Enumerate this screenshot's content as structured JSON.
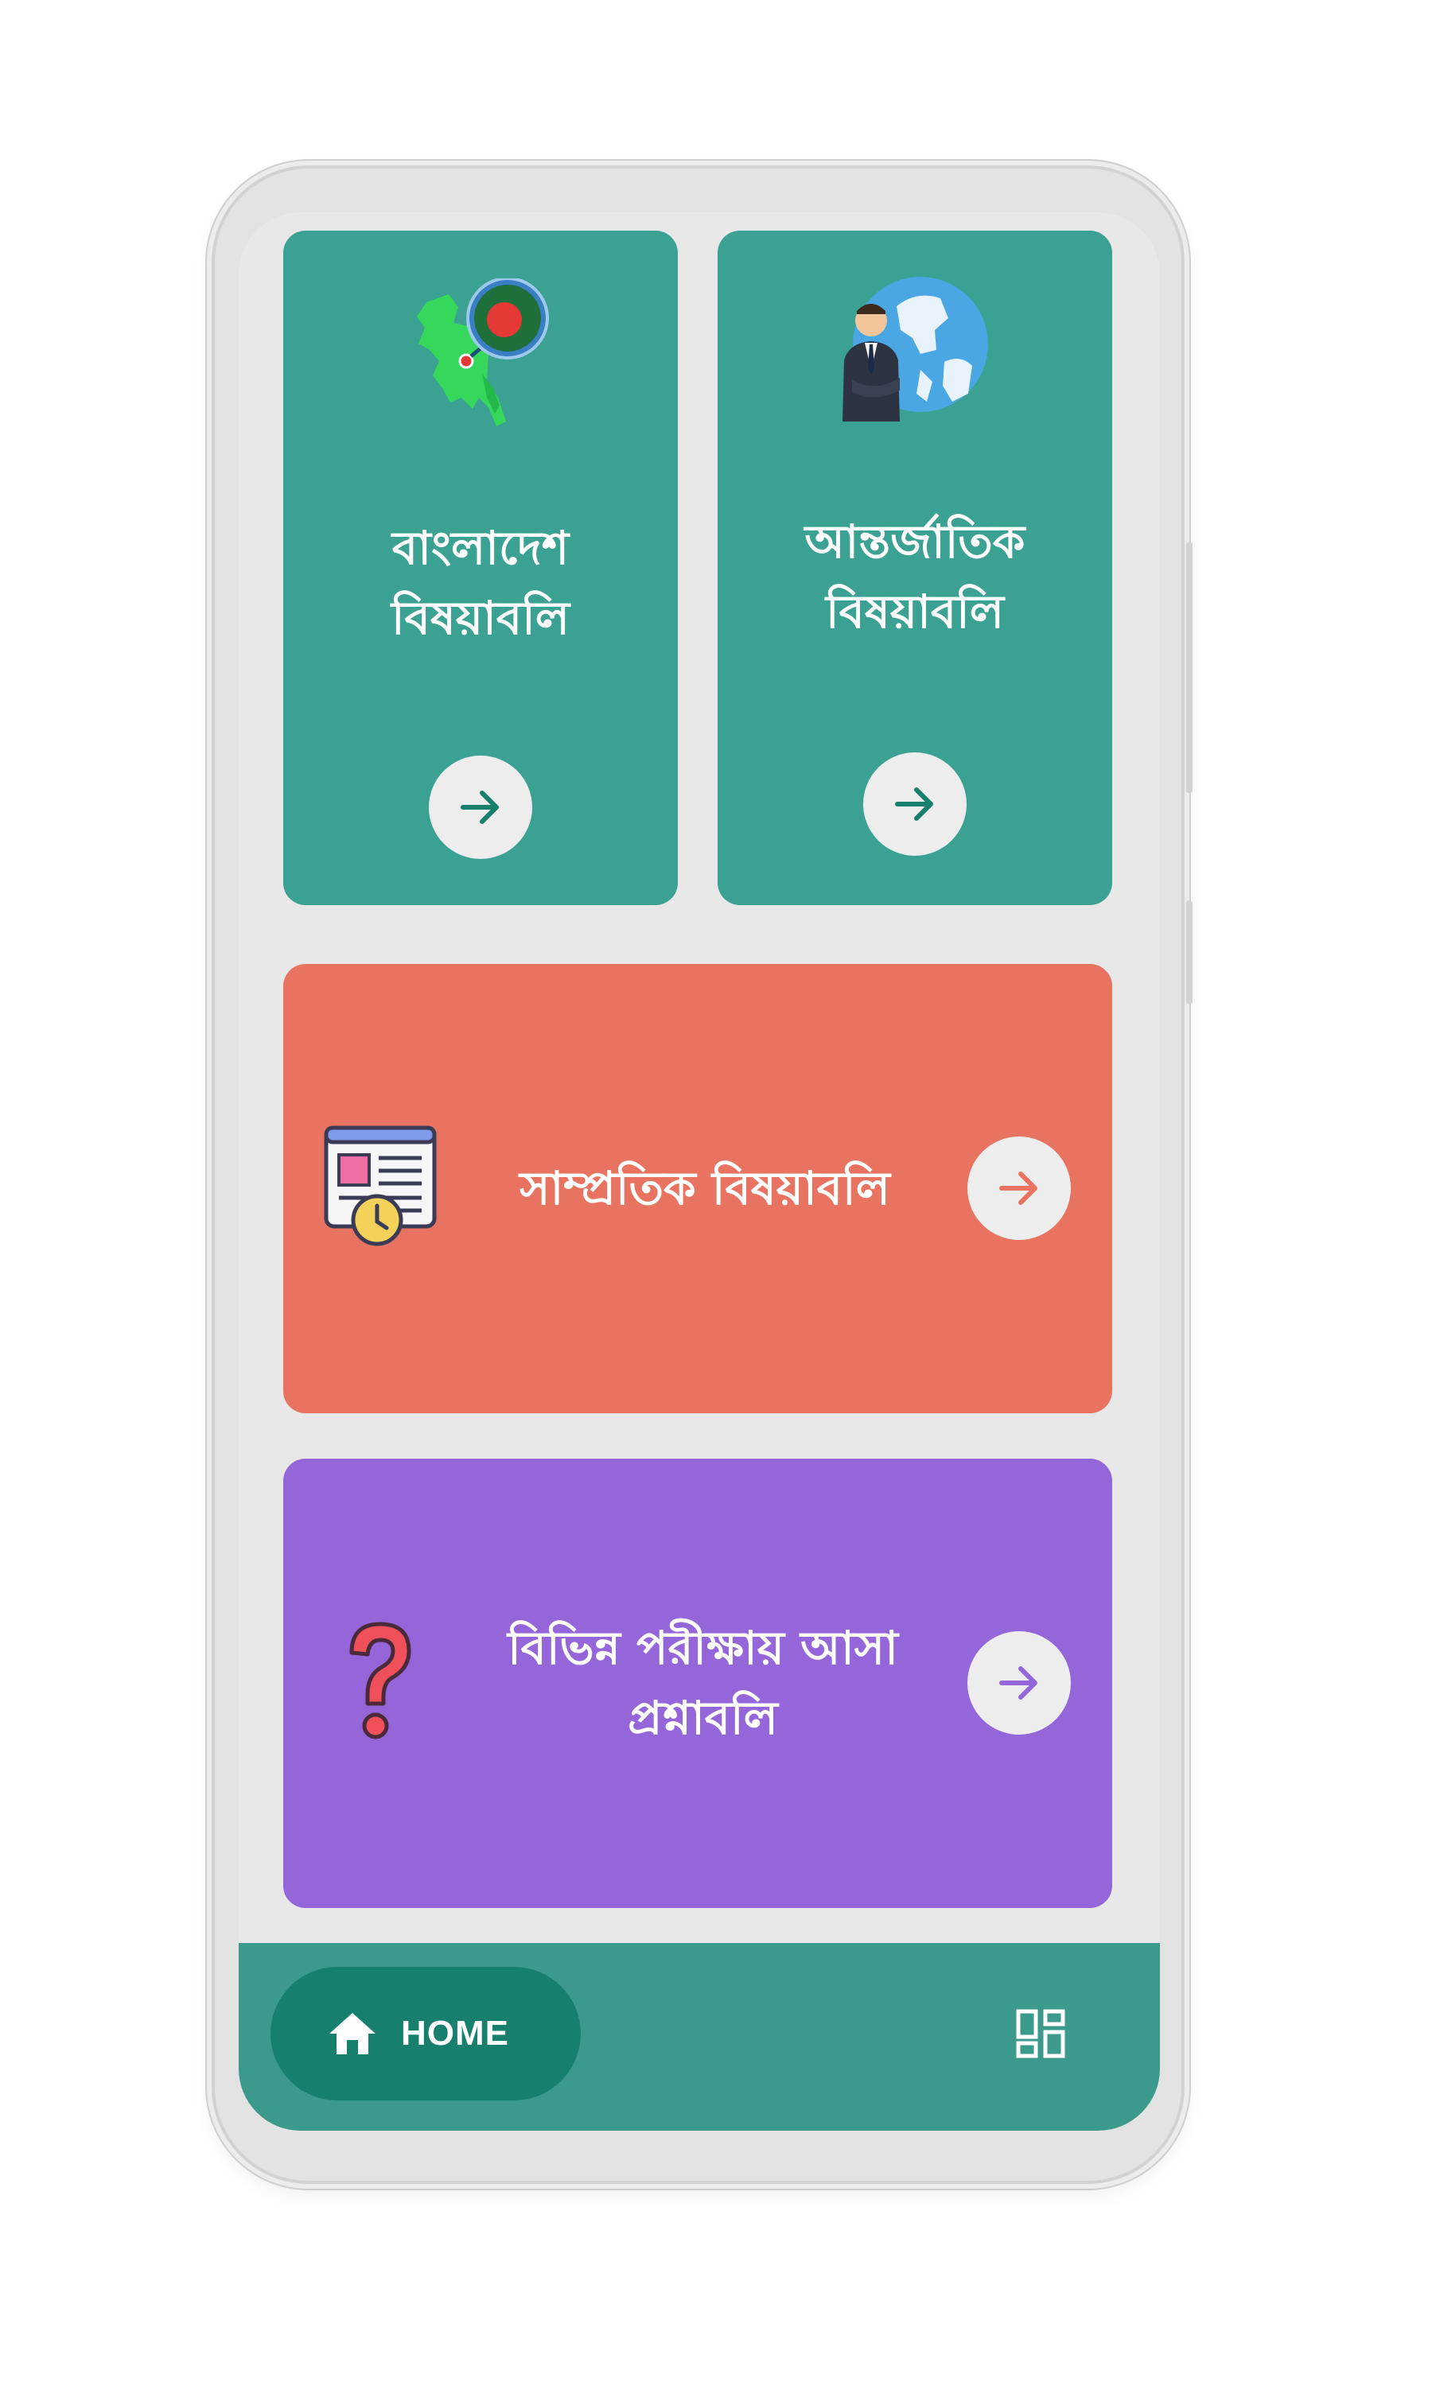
{
  "cards": {
    "bangladesh": {
      "title_line1": "বাংলাদেশ",
      "title_line2": "বিষয়াবলি"
    },
    "international": {
      "title_line1": "আন্তর্জাতিক",
      "title_line2": "বিষয়াবলি"
    },
    "current": {
      "title": "সাম্প্রতিক বিষয়াবলি"
    },
    "questions": {
      "title_line1": "বিভিন্ন পরীক্ষায় আসা",
      "title_line2": "প্রশ্নাবলি"
    }
  },
  "bottom_nav": {
    "home_label": "HOME"
  },
  "colors": {
    "teal": "#3ba193",
    "coral": "#e87361",
    "purple": "#9565da",
    "nav_bar": "#3b9a8b",
    "home_pill": "#17806d",
    "button_bg": "#ededed"
  },
  "icons": {
    "bangladesh_card": "bangladesh-map-flag-icon",
    "international_card": "businessman-globe-icon",
    "current_card": "newspaper-clock-icon",
    "questions_card": "question-mark-icon",
    "arrow": "arrow-right-icon",
    "home": "home-icon",
    "menu": "grid-menu-icon"
  }
}
